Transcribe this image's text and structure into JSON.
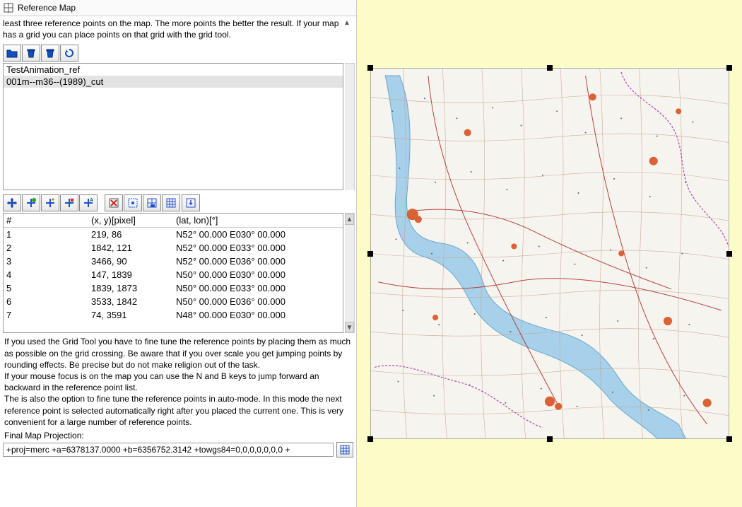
{
  "titlebar": {
    "title": "Reference Map"
  },
  "help_top": "least three reference points on the map. The more points the better the result. If your map has a grid you can place points on that grid with the grid tool.",
  "file_list": {
    "items": [
      {
        "name": "TestAnimation_ref",
        "selected": false
      },
      {
        "name": "001m--m36--(1989)_cut",
        "selected": true
      }
    ]
  },
  "points_table": {
    "headers": {
      "idx": "#",
      "xy": "(x, y)[pixel]",
      "ll": "(lat, lon)[°]"
    },
    "rows": [
      {
        "idx": "1",
        "xy": "219, 86",
        "ll": "N52° 00.000 E030° 00.000"
      },
      {
        "idx": "2",
        "xy": "1842, 121",
        "ll": "N52° 00.000 E033° 00.000"
      },
      {
        "idx": "3",
        "xy": "3466, 90",
        "ll": "N52° 00.000 E036° 00.000"
      },
      {
        "idx": "4",
        "xy": "147, 1839",
        "ll": "N50° 00.000 E030° 00.000"
      },
      {
        "idx": "5",
        "xy": "1839, 1873",
        "ll": "N50° 00.000 E033° 00.000"
      },
      {
        "idx": "6",
        "xy": "3533, 1842",
        "ll": "N50° 00.000 E036° 00.000"
      },
      {
        "idx": "7",
        "xy": "74, 3591",
        "ll": "N48° 00.000 E030° 00.000"
      }
    ]
  },
  "help_bottom": "If you used the Grid Tool you have to fine tune the reference points by placing them as much as possible on the grid crossing. Be aware that if you over scale you get jumping points by rounding effects. Be precise but do not make religion out of the task.\nIf your mouse focus is on the map you can use the N and B keys to jump forward an backward in the reference point list.\nThe is also the option to fine tune the reference points in auto-mode. In this mode the next reference point is selected automatically right after you placed the current one. This is very convenient for a large number of reference points.",
  "projection": {
    "label": "Final Map Projection:",
    "value": "+proj=merc +a=6378137.0000 +b=6356752.3142 +towgs84=0,0,0,0,0,0,0 +"
  }
}
